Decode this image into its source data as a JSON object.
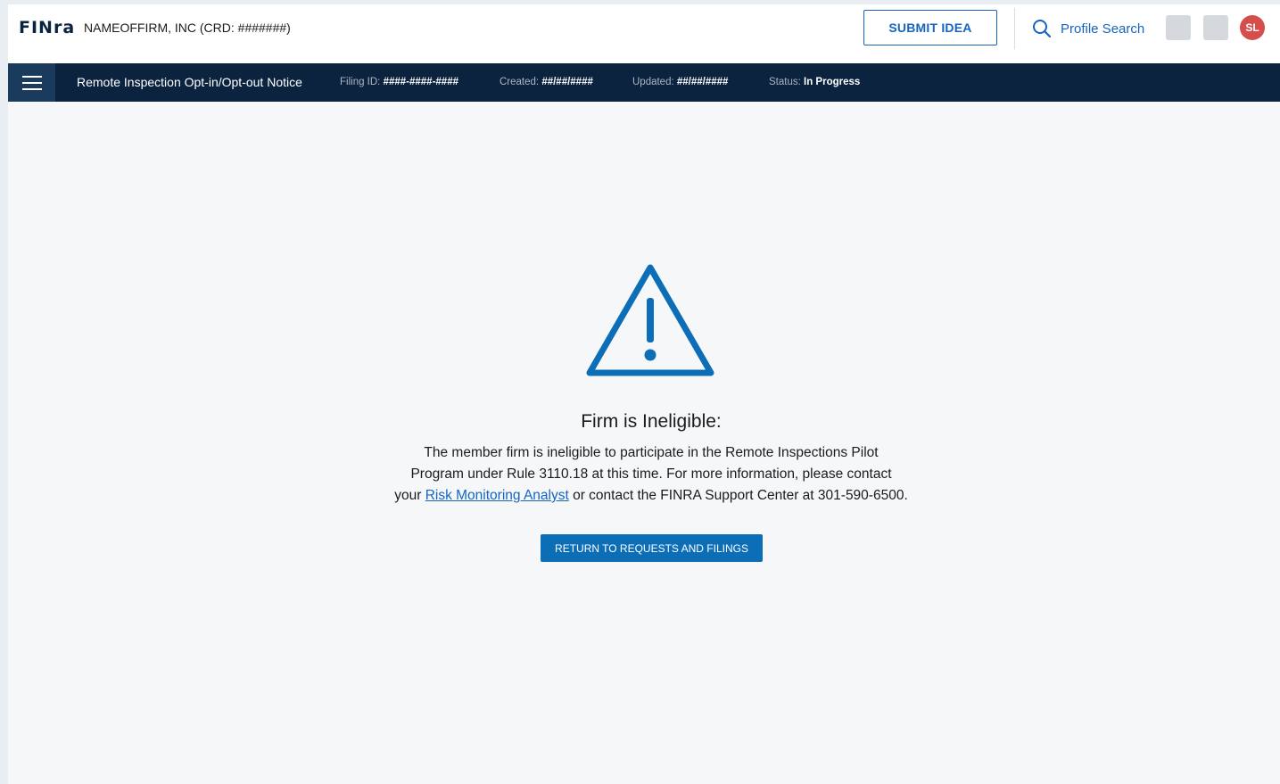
{
  "header": {
    "logo_text": "FINra",
    "firm_name": "NAMEOFFIRM, INC (CRD: #######)",
    "submit_idea_label": "SUBMIT IDEA",
    "profile_search_label": "Profile Search",
    "avatar_initials": "SL"
  },
  "filing_bar": {
    "title": "Remote Inspection Opt-in/Opt-out Notice",
    "filing_id_label": "Filing ID:",
    "filing_id_value": "####-####-####",
    "created_label": "Created:",
    "created_value": "##/##/####",
    "updated_label": "Updated:",
    "updated_value": "##/##/####",
    "status_label": "Status:",
    "status_value": "In Progress"
  },
  "message": {
    "icon": "warning-triangle-icon",
    "title": "Firm is Ineligible:",
    "line1": "The member firm is ineligible to participate in the Remote Inspections Pilot",
    "line2": "Program under Rule 3110.18 at this time. For more information, please contact",
    "line3_prefix": "your ",
    "line3_link": "Risk Monitoring Analyst",
    "line3_suffix": " or contact the FINRA Support Center at 301-590-6500.",
    "return_button_label": "RETURN TO REQUESTS AND FILINGS"
  },
  "colors": {
    "navy": "#0c2340",
    "accent_blue": "#1565c0",
    "button_blue": "#0d6eb8",
    "avatar_red": "#d54e4b",
    "page_bg": "#f5f7f9"
  }
}
